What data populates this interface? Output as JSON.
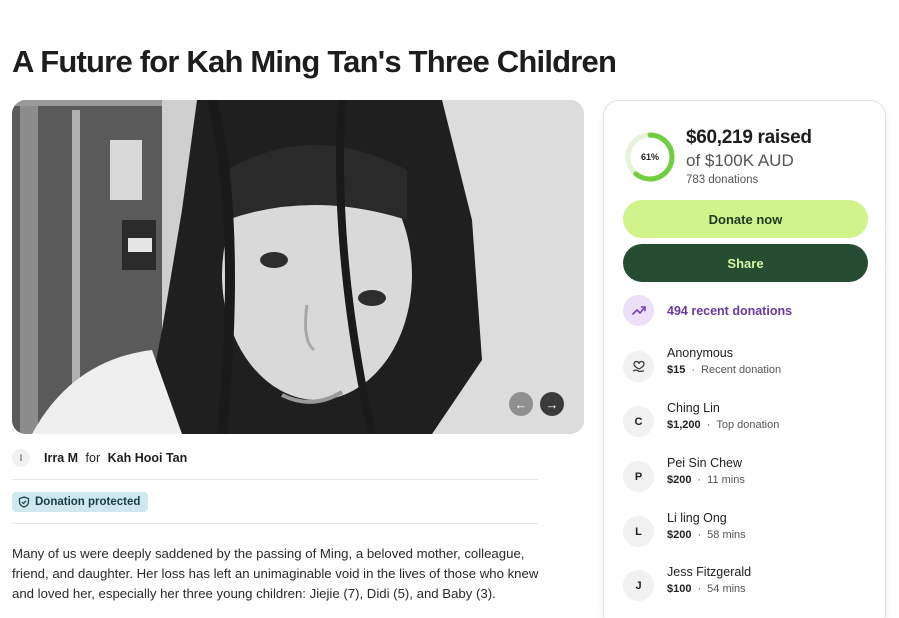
{
  "page": {
    "title": "A Future for Kah Ming Tan's Three Children"
  },
  "hero": {
    "prev_icon": "arrow-left-icon",
    "next_icon": "arrow-right-icon",
    "prev_glyph": "←",
    "next_glyph": "→"
  },
  "organizer": {
    "initial": "I",
    "name": "Irra M",
    "for_word": "for",
    "beneficiary": "Kah Hooi Tan"
  },
  "badge": {
    "label": "Donation protected",
    "icon": "shield-icon"
  },
  "story": {
    "text": "Many of us were deeply saddened by the passing of Ming, a beloved mother, colleague, friend, and daughter. Her loss has left an unimaginable void in the lives of those who knew and loved her, especially her three young children: Jiejie (7), Didi (5), and Baby (3)."
  },
  "fundraiser": {
    "percent_label": "61%",
    "progress": 0.61,
    "raised": "$60,219 raised",
    "goal": "of $100K AUD",
    "donations_count": "783 donations",
    "donate_label": "Donate now",
    "share_label": "Share",
    "recent_label": "494 recent donations",
    "accent_color": "#6fcf3f"
  },
  "donors": [
    {
      "avatar": "heart-hand-icon",
      "name": "Anonymous",
      "amount": "$15",
      "note": "Recent donation"
    },
    {
      "avatar": "C",
      "name": "Ching Lin",
      "amount": "$1,200",
      "note": "Top donation"
    },
    {
      "avatar": "P",
      "name": "Pei Sin Chew",
      "amount": "$200",
      "note": "11 mins"
    },
    {
      "avatar": "L",
      "name": "Li ling Ong",
      "amount": "$200",
      "note": "58 mins"
    },
    {
      "avatar": "J",
      "name": "Jess Fitzgerald",
      "amount": "$100",
      "note": "54 mins"
    }
  ]
}
